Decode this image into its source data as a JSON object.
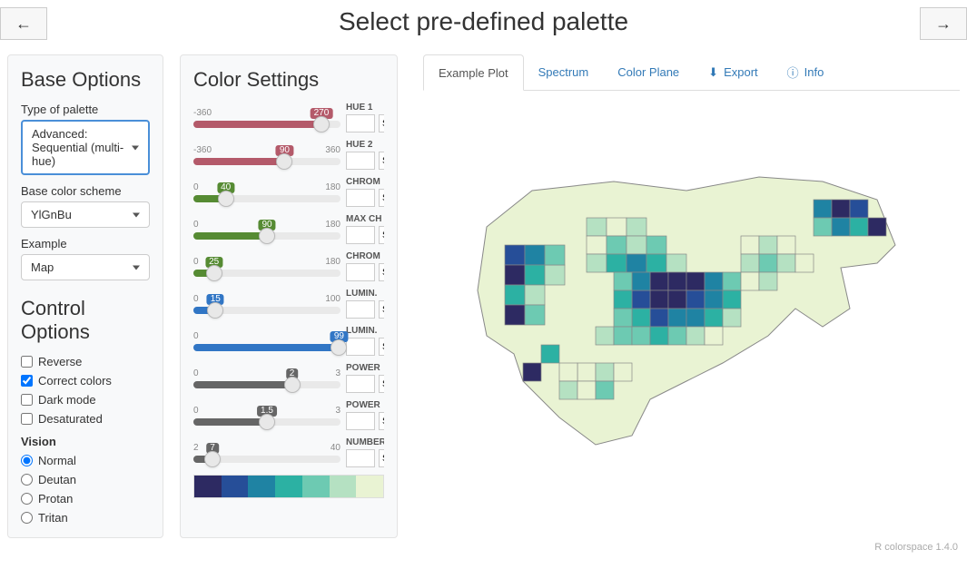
{
  "title": "Select pre-defined palette",
  "baseOptions": {
    "heading": "Base Options",
    "typeLabel": "Type of palette",
    "typeValue": "Advanced: Sequential (multi-hue)",
    "schemeLabel": "Base color scheme",
    "schemeValue": "YlGnBu",
    "exampleLabel": "Example",
    "exampleValue": "Map"
  },
  "controlOptions": {
    "heading": "Control Options",
    "reverse": {
      "label": "Reverse",
      "checked": false
    },
    "correct": {
      "label": "Correct colors",
      "checked": true
    },
    "dark": {
      "label": "Dark mode",
      "checked": false
    },
    "desat": {
      "label": "Desaturated",
      "checked": false
    },
    "visionHeading": "Vision",
    "vision": [
      {
        "label": "Normal",
        "checked": true
      },
      {
        "label": "Deutan",
        "checked": false
      },
      {
        "label": "Protan",
        "checked": false
      },
      {
        "label": "Tritan",
        "checked": false
      }
    ]
  },
  "colorSettings": {
    "heading": "Color Settings",
    "sliders": [
      {
        "label": "HUE 1",
        "min": "-360",
        "max": "",
        "val": "270",
        "pct": 87,
        "color": "#b45a6a"
      },
      {
        "label": "HUE 2",
        "min": "-360",
        "max": "360",
        "val": "90",
        "pct": 62,
        "color": "#b45a6a"
      },
      {
        "label": "CHROM",
        "min": "0",
        "max": "180",
        "val": "40",
        "pct": 22,
        "color": "#568b33"
      },
      {
        "label": "MAX CH",
        "min": "0",
        "max": "180",
        "val": "90",
        "pct": 50,
        "color": "#568b33"
      },
      {
        "label": "CHROM",
        "min": "0",
        "max": "180",
        "val": "25",
        "pct": 14,
        "color": "#568b33"
      },
      {
        "label": "LUMIN.",
        "min": "0",
        "max": "100",
        "val": "15",
        "pct": 15,
        "color": "#3176c5"
      },
      {
        "label": "LUMIN.",
        "min": "0",
        "max": "",
        "val": "99",
        "pct": 99,
        "color": "#3176c5"
      },
      {
        "label": "POWER",
        "min": "0",
        "max": "3",
        "val": "2",
        "pct": 67,
        "color": "#666666"
      },
      {
        "label": "POWER",
        "min": "0",
        "max": "3",
        "val": "1.5",
        "pct": 50,
        "color": "#666666"
      },
      {
        "label": "NUMBER",
        "min": "2",
        "max": "40",
        "val": "7",
        "pct": 13,
        "color": "#666666"
      }
    ],
    "setLabel": "SET",
    "swatches": [
      "#2d2a62",
      "#264e98",
      "#1f83a3",
      "#2cb1a3",
      "#6dcab2",
      "#b5e1c2",
      "#e9f3d3"
    ]
  },
  "tabs": [
    {
      "label": "Example Plot",
      "active": true,
      "icon": ""
    },
    {
      "label": "Spectrum",
      "active": false,
      "icon": ""
    },
    {
      "label": "Color Plane",
      "active": false,
      "icon": ""
    },
    {
      "label": "Export",
      "active": false,
      "icon": "download"
    },
    {
      "label": "Info",
      "active": false,
      "icon": "info"
    }
  ],
  "footer": "R colorspace 1.4.0"
}
